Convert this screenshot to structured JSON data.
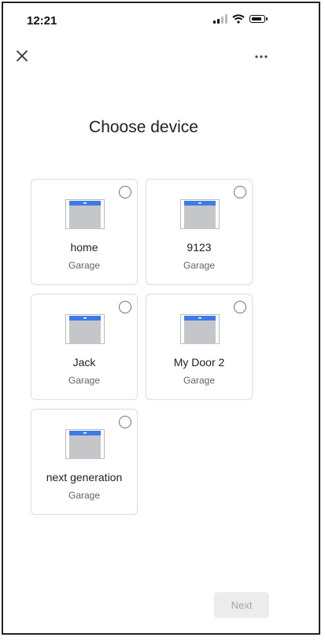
{
  "status_bar": {
    "time": "12:21"
  },
  "header": {
    "title": "Choose device"
  },
  "devices": [
    {
      "name": "home",
      "type": "Garage"
    },
    {
      "name": "9123",
      "type": "Garage"
    },
    {
      "name": "Jack",
      "type": "Garage"
    },
    {
      "name": "My Door 2",
      "type": "Garage"
    },
    {
      "name": "next generation",
      "type": "Garage"
    }
  ],
  "footer": {
    "next_label": "Next"
  },
  "icons": {
    "close": "close-icon",
    "more": "more-horizontal-icon",
    "device": "garage-door-icon"
  },
  "colors": {
    "accent": "#3d7be8",
    "door": "#c4c6c9",
    "disabled_bg": "#ececec",
    "disabled_text": "#a6a6a6"
  }
}
